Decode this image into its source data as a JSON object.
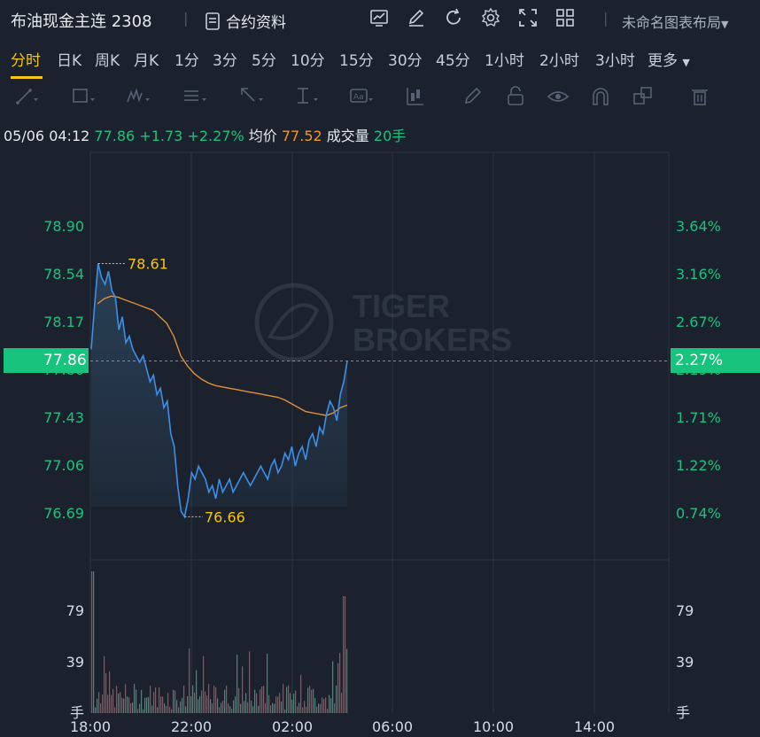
{
  "header": {
    "title": "布油现金主连 2308",
    "contract_label": "合约资料",
    "layout_name": "未命名图表布局",
    "icons": [
      "chart-icon",
      "edit-icon",
      "refresh-icon",
      "settings-icon",
      "fullscreen-icon",
      "grid-layout-icon"
    ]
  },
  "periods": {
    "items": [
      "分时",
      "日K",
      "周K",
      "月K",
      "1分",
      "3分",
      "5分",
      "10分",
      "15分",
      "30分",
      "45分",
      "1小时",
      "2小时",
      "3小时",
      "更多"
    ],
    "active": "分时"
  },
  "drawing_tools": [
    "line-tool-icon",
    "rectangle-tool-icon",
    "wave-tool-icon",
    "fib-tool-icon",
    "arrow-tool-icon",
    "measure-tool-icon",
    "text-tool-icon",
    "candle-tool-icon",
    "pen-icon",
    "lock-icon",
    "eye-icon",
    "magnet-icon",
    "layers-icon",
    "trash-icon"
  ],
  "info": {
    "datetime": "05/06 04:12",
    "price": "77.86",
    "change": "+1.73",
    "change_pct": "+2.27%",
    "avg_label": "均价",
    "avg_value": "77.52",
    "volume_label": "成交量",
    "volume_value": "20手"
  },
  "watermark": {
    "line1": "TIGER",
    "line2": "BROKERS"
  },
  "chart_data": {
    "type": "line",
    "price_ticks": [
      "78.90",
      "78.54",
      "78.17",
      "77.80",
      "77.43",
      "77.06",
      "76.69"
    ],
    "pct_ticks": [
      "3.64%",
      "3.16%",
      "2.67%",
      "2.19%",
      "1.71%",
      "1.22%",
      "0.74%"
    ],
    "current_price_tag": "77.86",
    "current_pct_tag": "2.27%",
    "high_label": "78.61",
    "low_label": "76.66",
    "volume_ticks": [
      "79",
      "39",
      "手"
    ],
    "time_ticks": [
      "18:00",
      "22:00",
      "02:00",
      "06:00",
      "10:00",
      "14:00"
    ],
    "colors": {
      "price": "#3d8fe8",
      "avg": "#e0903a",
      "up": "#1fc07d",
      "down": "#e04e4e"
    },
    "series": [
      {
        "name": "price",
        "values": [
          77.95,
          78.3,
          78.61,
          78.5,
          78.45,
          78.55,
          78.4,
          78.35,
          78.1,
          78.2,
          78.0,
          78.05,
          77.95,
          77.9,
          77.85,
          77.9,
          77.8,
          77.7,
          77.75,
          77.6,
          77.65,
          77.5,
          77.55,
          77.3,
          77.2,
          76.9,
          76.7,
          76.66,
          76.8,
          77.0,
          76.95,
          77.05,
          77.0,
          76.95,
          76.85,
          76.9,
          76.8,
          76.95,
          76.85,
          76.9,
          76.95,
          76.85,
          76.9,
          76.95,
          77.0,
          76.95,
          76.9,
          76.95,
          77.0,
          77.05,
          77.0,
          76.95,
          77.05,
          77.1,
          77.0,
          77.05,
          77.15,
          77.1,
          77.2,
          77.05,
          77.15,
          77.2,
          77.1,
          77.25,
          77.3,
          77.2,
          77.35,
          77.3,
          77.45,
          77.55,
          77.5,
          77.4,
          77.6,
          77.7,
          77.86
        ]
      },
      {
        "name": "avg",
        "values": [
          78.3,
          78.34,
          78.36,
          78.35,
          78.33,
          78.31,
          78.29,
          78.27,
          78.25,
          78.2,
          78.15,
          78.05,
          77.9,
          77.82,
          77.76,
          77.72,
          77.69,
          77.67,
          77.66,
          77.65,
          77.64,
          77.63,
          77.62,
          77.61,
          77.6,
          77.59,
          77.58,
          77.56,
          77.53,
          77.5,
          77.47,
          77.46,
          77.45,
          77.44,
          77.46,
          77.5,
          77.52
        ]
      }
    ]
  }
}
